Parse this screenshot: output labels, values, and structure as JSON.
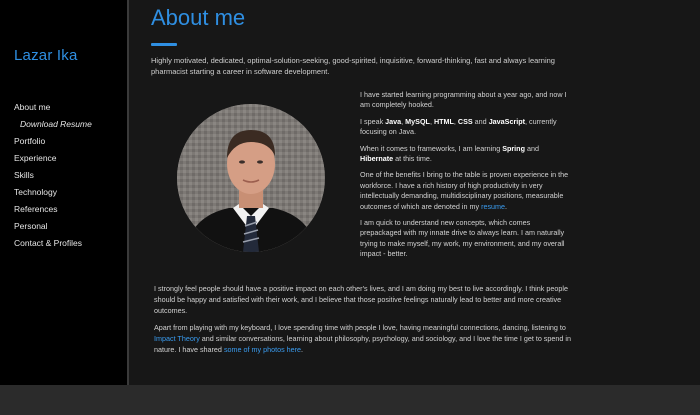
{
  "sidebar": {
    "brand": "Lazar Ika",
    "items": [
      {
        "label": "About me"
      },
      {
        "label": "Download Resume"
      },
      {
        "label": "Portfolio"
      },
      {
        "label": "Experience"
      },
      {
        "label": "Skills"
      },
      {
        "label": "Technology"
      },
      {
        "label": "References"
      },
      {
        "label": "Personal"
      },
      {
        "label": "Contact & Profiles"
      }
    ]
  },
  "main": {
    "title": "About me",
    "intro": "Highly motivated, dedicated, optimal-solution-seeking, good-spirited, inquisitive, forward-thinking, fast and always learning pharmacist starting a career in software development.",
    "p1": "I have started learning programming about a year ago, and now I am completely hooked.",
    "p2": {
      "a": "I speak ",
      "java": "Java",
      "sep1": ", ",
      "mysql": "MySQL",
      "sep2": ", ",
      "html": "HTML",
      "sep3": ", ",
      "css": "CSS",
      "sep4": " and ",
      "js": "JavaScript",
      "b": ", currently focusing on Java."
    },
    "p3": {
      "a": "When it comes to frameworks, I am learning ",
      "spring": "Spring",
      "and": " and ",
      "hibernate": "Hibernate",
      "b": " at this time."
    },
    "p4": {
      "a": "One of the benefits I bring to the table is proven experience in the workforce. I have a rich history of high productivity in very intellectually demanding, multidisciplinary positions, measurable outcomes of which are denoted in my ",
      "link": "resume",
      "b": "."
    },
    "p5": "I am quick to understand new concepts, which comes prepackaged with my innate drive to always learn. I am naturally trying to make myself, my work, my environment, and my overall impact - better.",
    "b1": "I strongly feel people should have a positive impact on each other's lives, and I am doing my best to live accordingly. I think people should be happy and satisfied with their work, and I believe that those positive feelings naturally lead to better and more creative outcomes.",
    "b2": {
      "a": "Apart from playing with my keyboard, I love spending time with people I love, having meaningful connections, dancing, listening to ",
      "link1": "Impact Theory",
      "b": " and similar conversations, learning about philosophy, psychology, and sociology, and I love the time I get to spend in nature. I have shared ",
      "link2": "some of my photos here",
      "c": "."
    }
  },
  "colors": {
    "accent": "#2f8fe2",
    "link": "#3a9cf0",
    "sidebar_bg": "#000000",
    "main_bg": "#171717"
  }
}
